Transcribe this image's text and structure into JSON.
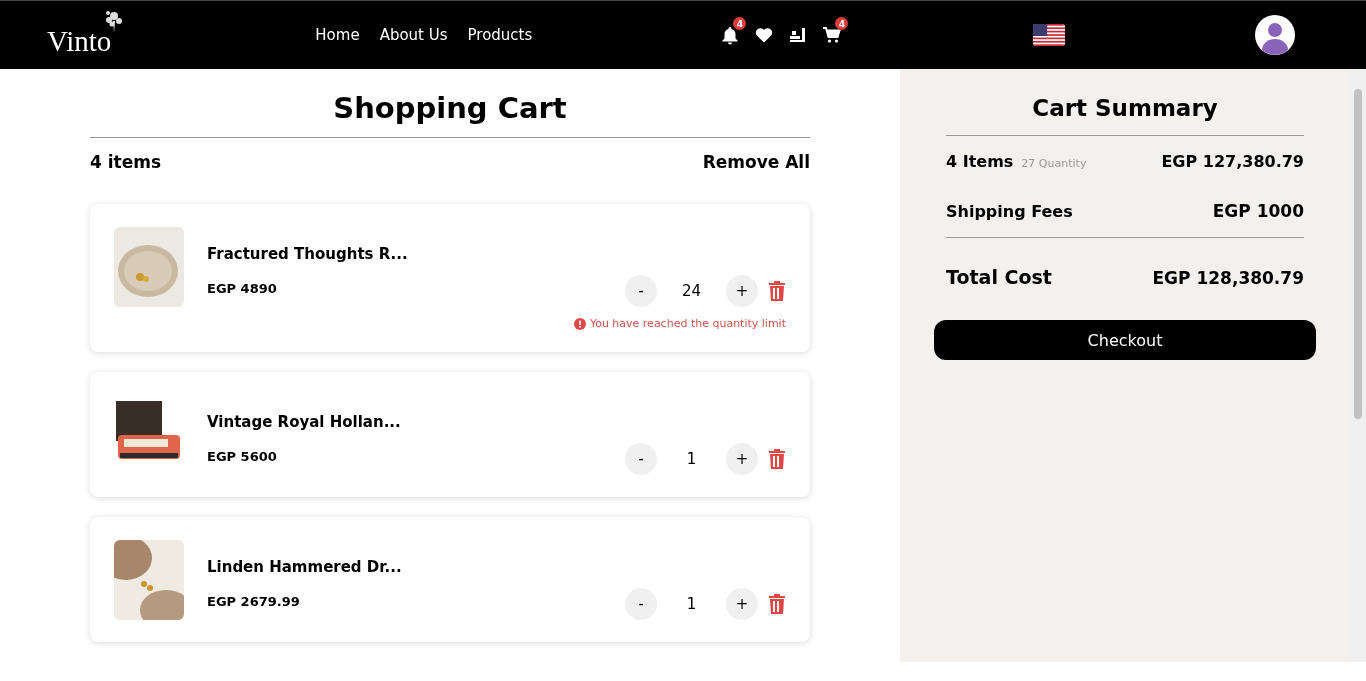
{
  "header": {
    "logo": "Vinto",
    "nav": [
      {
        "label": "Home"
      },
      {
        "label": "About Us"
      },
      {
        "label": "Products"
      }
    ],
    "icons": [
      {
        "kind": "bell",
        "badge": "4"
      },
      {
        "kind": "heart"
      },
      {
        "kind": "truck"
      },
      {
        "kind": "cart",
        "badge": "4"
      }
    ]
  },
  "cart": {
    "title": "Shopping Cart",
    "count": "4 items",
    "remove_all": "Remove All",
    "items": [
      {
        "name": "Fractured Thoughts R...",
        "price": "EGP 4890",
        "quantity": "24",
        "minus": "-",
        "plus": "+",
        "warning": "You have reached the quantity limit"
      },
      {
        "name": "Vintage Royal Hollan...",
        "price": "EGP 5600",
        "quantity": "1",
        "minus": "-",
        "plus": "+"
      },
      {
        "name": "Linden Hammered Dr...",
        "price": "EGP 2679.99",
        "quantity": "1",
        "minus": "-",
        "plus": "+"
      }
    ]
  },
  "summary": {
    "title": "Cart Summary",
    "items_label": "4 Items",
    "quantity": "27 Quantity",
    "items_total": "EGP 127,380.79",
    "shipping_label": "Shipping Fees",
    "shipping": "EGP 1000",
    "total_label": "Total Cost",
    "total": "EGP 128,380.79",
    "checkout": "Checkout"
  }
}
